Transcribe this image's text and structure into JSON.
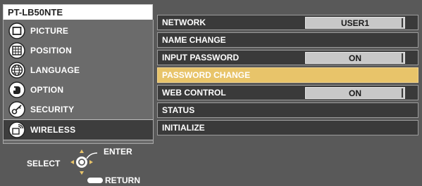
{
  "model": "PT-LB50NTE",
  "menu": [
    {
      "label": "PICTURE",
      "icon": "picture-icon"
    },
    {
      "label": "POSITION",
      "icon": "position-icon"
    },
    {
      "label": "LANGUAGE",
      "icon": "language-icon"
    },
    {
      "label": "OPTION",
      "icon": "option-icon"
    },
    {
      "label": "SECURITY",
      "icon": "security-icon"
    },
    {
      "label": "WIRELESS",
      "icon": "wireless-icon"
    }
  ],
  "help": {
    "select": "SELECT",
    "enter": "ENTER",
    "return": "RETURN"
  },
  "settings": [
    {
      "label": "NETWORK",
      "value": "USER1"
    },
    {
      "label": "NAME CHANGE",
      "value": ""
    },
    {
      "label": "INPUT PASSWORD",
      "value": "ON"
    },
    {
      "label": "PASSWORD CHANGE",
      "value": ""
    },
    {
      "label": "WEB CONTROL",
      "value": "ON"
    },
    {
      "label": "STATUS",
      "value": ""
    },
    {
      "label": "INITIALIZE",
      "value": ""
    }
  ],
  "colors": {
    "background": "#595959",
    "highlight": "#e8c46a",
    "value_box": "#c8c8c8",
    "accent_arrow": "#e8c46a"
  }
}
